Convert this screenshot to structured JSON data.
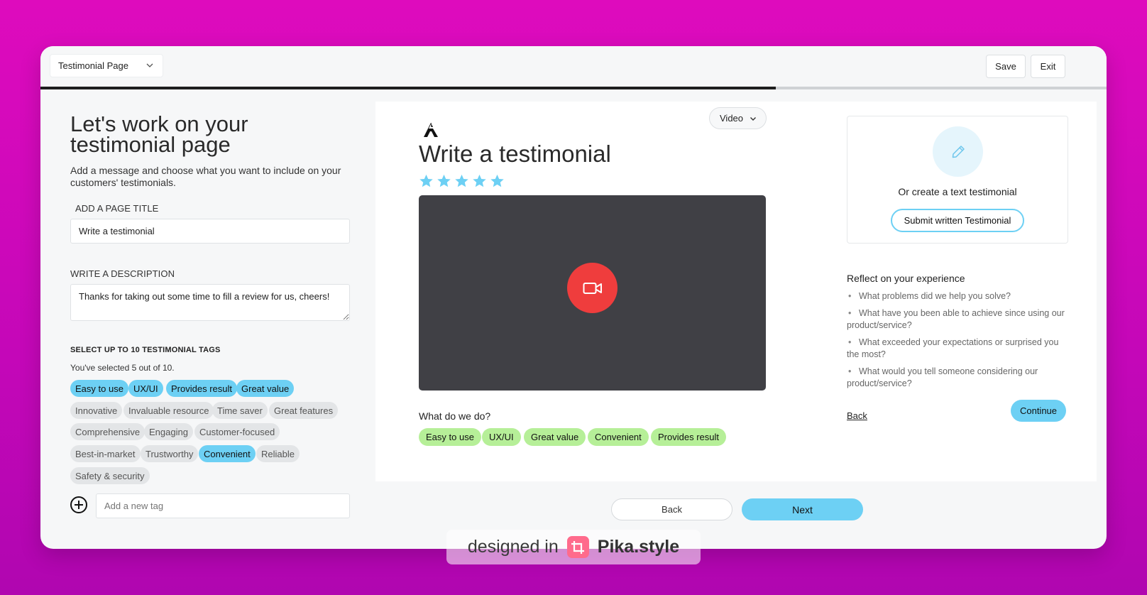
{
  "topbar": {
    "page_select": "Testimonial Page",
    "save_label": "Save",
    "exit_label": "Exit",
    "progress": 0.69
  },
  "left": {
    "heading_line1": "Let's work on your",
    "heading_line2": "testimonial page",
    "subtext": "Add a message and choose what you want to include on your customers' testimonials.",
    "title_label": "ADD A PAGE TITLE",
    "title_value": "Write a testimonial",
    "desc_label": "WRITE A DESCRIPTION",
    "desc_value": "Thanks for taking out some time to fill a review for us, cheers!",
    "tags_heading": "SELECT UP TO 10 TESTIMONIAL TAGS",
    "tags_count": "You've selected 5 out of 10.",
    "tags": [
      {
        "label": "Easy to use",
        "selected": true
      },
      {
        "label": "UX/UI",
        "selected": true
      },
      {
        "label": "Provides result",
        "selected": true
      },
      {
        "label": "Great value",
        "selected": true
      },
      {
        "label": "Innovative",
        "selected": false
      },
      {
        "label": "Invaluable resource",
        "selected": false
      },
      {
        "label": "Time saver",
        "selected": false
      },
      {
        "label": "Great features",
        "selected": false
      },
      {
        "label": "Comprehensive",
        "selected": false
      },
      {
        "label": "Engaging",
        "selected": false
      },
      {
        "label": "Customer-focused",
        "selected": false
      },
      {
        "label": "Best-in-market",
        "selected": false
      },
      {
        "label": "Trustworthy",
        "selected": false
      },
      {
        "label": "Convenient",
        "selected": true
      },
      {
        "label": "Reliable",
        "selected": false
      },
      {
        "label": "Safety & security",
        "selected": false
      }
    ],
    "add_tag_placeholder": "Add a new tag"
  },
  "preview": {
    "mode_select": "Video",
    "title": "Write a testimonial",
    "rating": 5,
    "what_label": "What do we do?",
    "tags": [
      "Easy to use",
      "UX/UI",
      "Great value",
      "Convenient",
      "Provides result"
    ],
    "text_option": "Or create a text testimonial",
    "submit_label": "Submit written Testimonial",
    "reflect_title": "Reflect on your experience",
    "reflect_items": [
      "What problems did we help you solve?",
      "What have you been able to achieve since using our product/service?",
      "What exceeded your expectations or surprised you the most?",
      "What would you tell someone considering our product/service?"
    ],
    "back_label": "Back",
    "continue_label": "Continue"
  },
  "footer": {
    "back_label": "Back",
    "next_label": "Next"
  },
  "watermark": {
    "prefix": "designed in",
    "brand": "Pika.style"
  },
  "colors": {
    "accent": "#6dd0f4",
    "record": "#ef3d3d",
    "tag_green": "#b6ef98",
    "background": "#d60abb"
  }
}
